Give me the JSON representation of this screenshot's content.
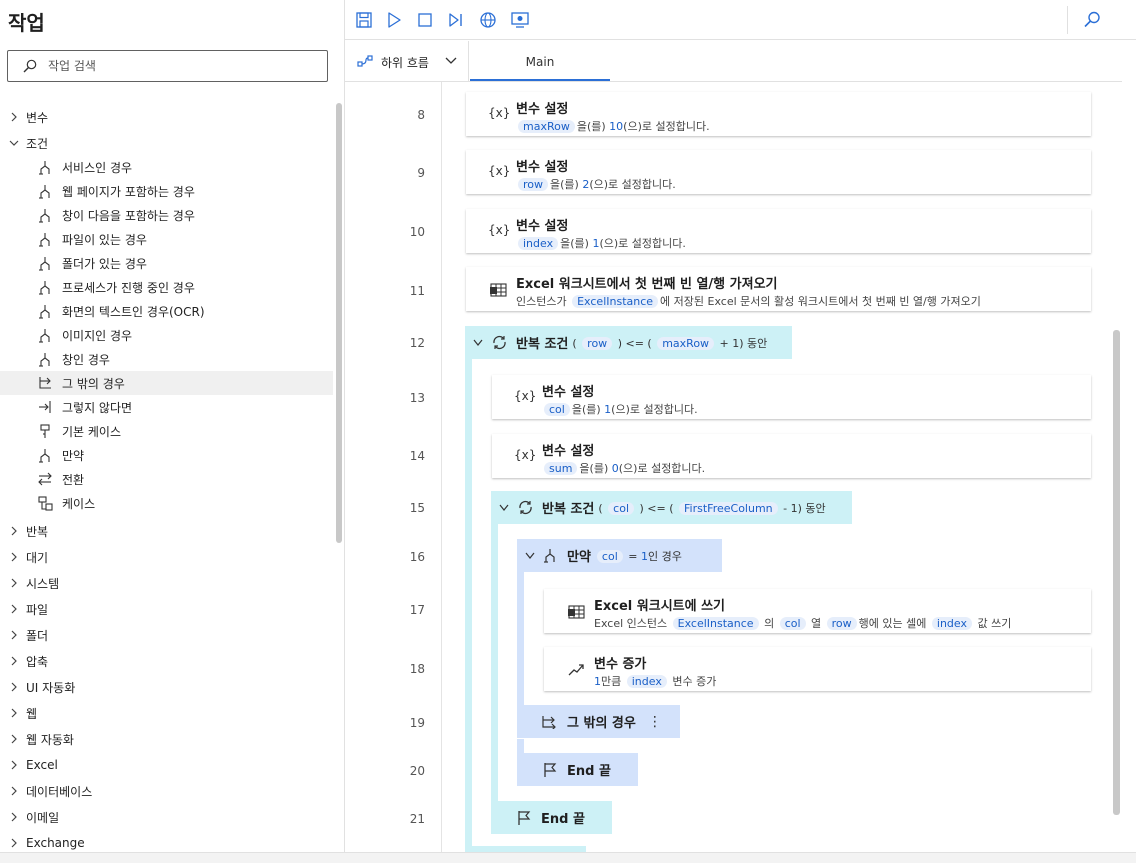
{
  "left_panel": {
    "title": "작업",
    "search_placeholder": "작업 검색",
    "categories_top": [
      {
        "label": "변수",
        "expanded": false
      },
      {
        "label": "조건",
        "expanded": true
      }
    ],
    "condition_children": [
      {
        "label": "서비스인 경우",
        "icon": "if-icon"
      },
      {
        "label": "웹 페이지가 포함하는 경우",
        "icon": "if-icon"
      },
      {
        "label": "창이 다음을 포함하는 경우",
        "icon": "if-icon"
      },
      {
        "label": "파일이 있는 경우",
        "icon": "if-icon"
      },
      {
        "label": "폴더가 있는 경우",
        "icon": "if-icon"
      },
      {
        "label": "프로세스가 진행 중인 경우",
        "icon": "if-icon"
      },
      {
        "label": "화면의 텍스트인 경우(OCR)",
        "icon": "if-icon"
      },
      {
        "label": "이미지인 경우",
        "icon": "if-icon"
      },
      {
        "label": "창인 경우",
        "icon": "if-icon"
      },
      {
        "label": "그 밖의 경우",
        "icon": "else-icon",
        "selected": true
      },
      {
        "label": "그렇지 않다면",
        "icon": "else-if-icon"
      },
      {
        "label": "기본 케이스",
        "icon": "default-case-icon"
      },
      {
        "label": "만약",
        "icon": "if-icon"
      },
      {
        "label": "전환",
        "icon": "switch-icon"
      },
      {
        "label": "케이스",
        "icon": "case-icon"
      }
    ],
    "categories_bottom": [
      "반복",
      "대기",
      "시스템",
      "파일",
      "폴더",
      "압축",
      "UI 자동화",
      "웹",
      "웹 자동화",
      "Excel",
      "데이터베이스",
      "이메일",
      "Exchange"
    ]
  },
  "toolbar": {
    "buttons": [
      "save-icon",
      "run-icon",
      "stop-icon",
      "run-next-action-icon",
      "web-recorder-icon",
      "desktop-recorder-icon",
      "search-icon"
    ]
  },
  "tabs": {
    "subflow_label": "하위 흐름",
    "main_label": "Main"
  },
  "flow": {
    "line_numbers": [
      "8",
      "9",
      "10",
      "11",
      "12",
      "13",
      "14",
      "15",
      "16",
      "17",
      "18",
      "19",
      "20",
      "21"
    ],
    "a8": {
      "icon": "{x}",
      "title": "변수 설정",
      "var": "maxRow",
      "mid": "을(를)",
      "value": "10",
      "tail": "(으)로 설정합니다."
    },
    "a9": {
      "icon": "{x}",
      "title": "변수 설정",
      "var": "row",
      "mid": "을(를)",
      "value": "2",
      "tail": "(으)로 설정합니다."
    },
    "a10": {
      "icon": "{x}",
      "title": "변수 설정",
      "var": "index",
      "mid": "을(를)",
      "value": "1",
      "tail": "(으)로 설정합니다."
    },
    "a11": {
      "title": "Excel 워크시트에서 첫 번째 빈 열/행 가져오기",
      "pre": "인스턴스가",
      "var": "ExcelInstance",
      "tail": "에 저장된 Excel 문서의 활성 워크시트에서 첫 번째 빈 열/행 가져오기"
    },
    "a12": {
      "title": "반복 조건",
      "p1": "(",
      "var1": "row",
      "p2": ") <= (",
      "var2": "maxRow",
      "p3": "+ 1) 동안"
    },
    "a13": {
      "icon": "{x}",
      "title": "변수 설정",
      "var": "col",
      "mid": "을(를)",
      "value": "1",
      "tail": "(으)로 설정합니다."
    },
    "a14": {
      "icon": "{x}",
      "title": "변수 설정",
      "var": "sum",
      "mid": "을(를)",
      "value": "0",
      "tail": "(으)로 설정합니다."
    },
    "a15": {
      "title": "반복 조건",
      "p1": "(",
      "var1": "col",
      "p2": ") <= (",
      "var2": "FirstFreeColumn",
      "p3": "- 1) 동안"
    },
    "a16": {
      "title": "만약",
      "var": "col",
      "mid": "=",
      "value": "1",
      "tail": "인 경우"
    },
    "a17": {
      "title": "Excel 워크시트에 쓰기",
      "pre": "Excel 인스턴스",
      "var1": "ExcelInstance",
      "t1": "의",
      "var2": "col",
      "t2": "열",
      "var3": "row",
      "t3": "행에 있는 셀에",
      "var4": "index",
      "t4": "값 쓰기"
    },
    "a18": {
      "title": "변수 증가",
      "value": "1",
      "mid": "만큼",
      "var": "index",
      "tail": "변수 증가"
    },
    "a19": {
      "title": "그 밖의 경우",
      "more": "⋮"
    },
    "a20": {
      "title": "End 끝"
    },
    "a21": {
      "title": "End 끝"
    }
  },
  "colors": {
    "loop_bg": "#cdf1f6",
    "if_bg": "#d3e2fb",
    "var_token_bg": "#e6eefb",
    "var_token_text": "#1a5fc7",
    "accent": "#2b6fd6"
  }
}
